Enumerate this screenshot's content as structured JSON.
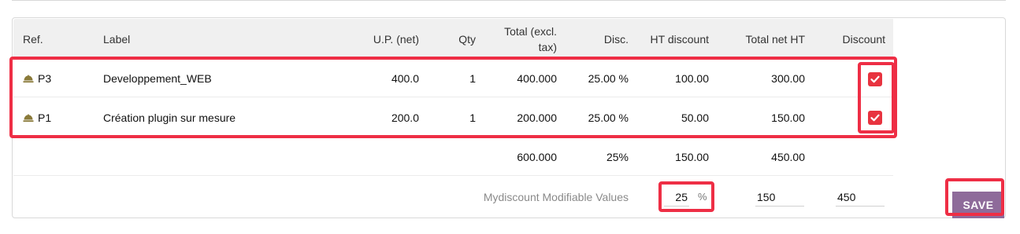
{
  "table": {
    "headers": {
      "ref": "Ref.",
      "label": "Label",
      "up": "U.P. (net)",
      "qty": "Qty",
      "total_line1": "Total (excl.",
      "total_line2": "tax)",
      "disc": "Disc.",
      "ht_discount": "HT discount",
      "total_net_ht": "Total net HT",
      "discount": "Discount"
    },
    "rows": [
      {
        "ref": "P3",
        "label": "Developpement_WEB",
        "up": "400.0",
        "qty": "1",
        "total": "400.000",
        "disc": "25.00 %",
        "ht_discount": "100.00",
        "total_net_ht": "300.00",
        "discount_checked": true
      },
      {
        "ref": "P1",
        "label": "Création plugin sur mesure",
        "up": "200.0",
        "qty": "1",
        "total": "200.000",
        "disc": "25.00 %",
        "ht_discount": "50.00",
        "total_net_ht": "150.00",
        "discount_checked": true
      }
    ],
    "totals": {
      "total": "600.000",
      "disc": "25%",
      "ht_discount": "150.00",
      "total_net_ht": "450.00"
    }
  },
  "modifiable": {
    "label": "Mydiscount Modifiable Values",
    "discount_value": "25",
    "discount_unit": "%",
    "ht_discount_value": "150",
    "total_net_ht_value": "450"
  },
  "save_label": "SAVE",
  "icons": {
    "product": "product-bell-icon",
    "check": "check-icon"
  },
  "colors": {
    "highlight": "#ee2e45",
    "checkbox": "#e8333f",
    "save_button": "#8e6b9a",
    "product_icon": "#8a7a3a"
  }
}
